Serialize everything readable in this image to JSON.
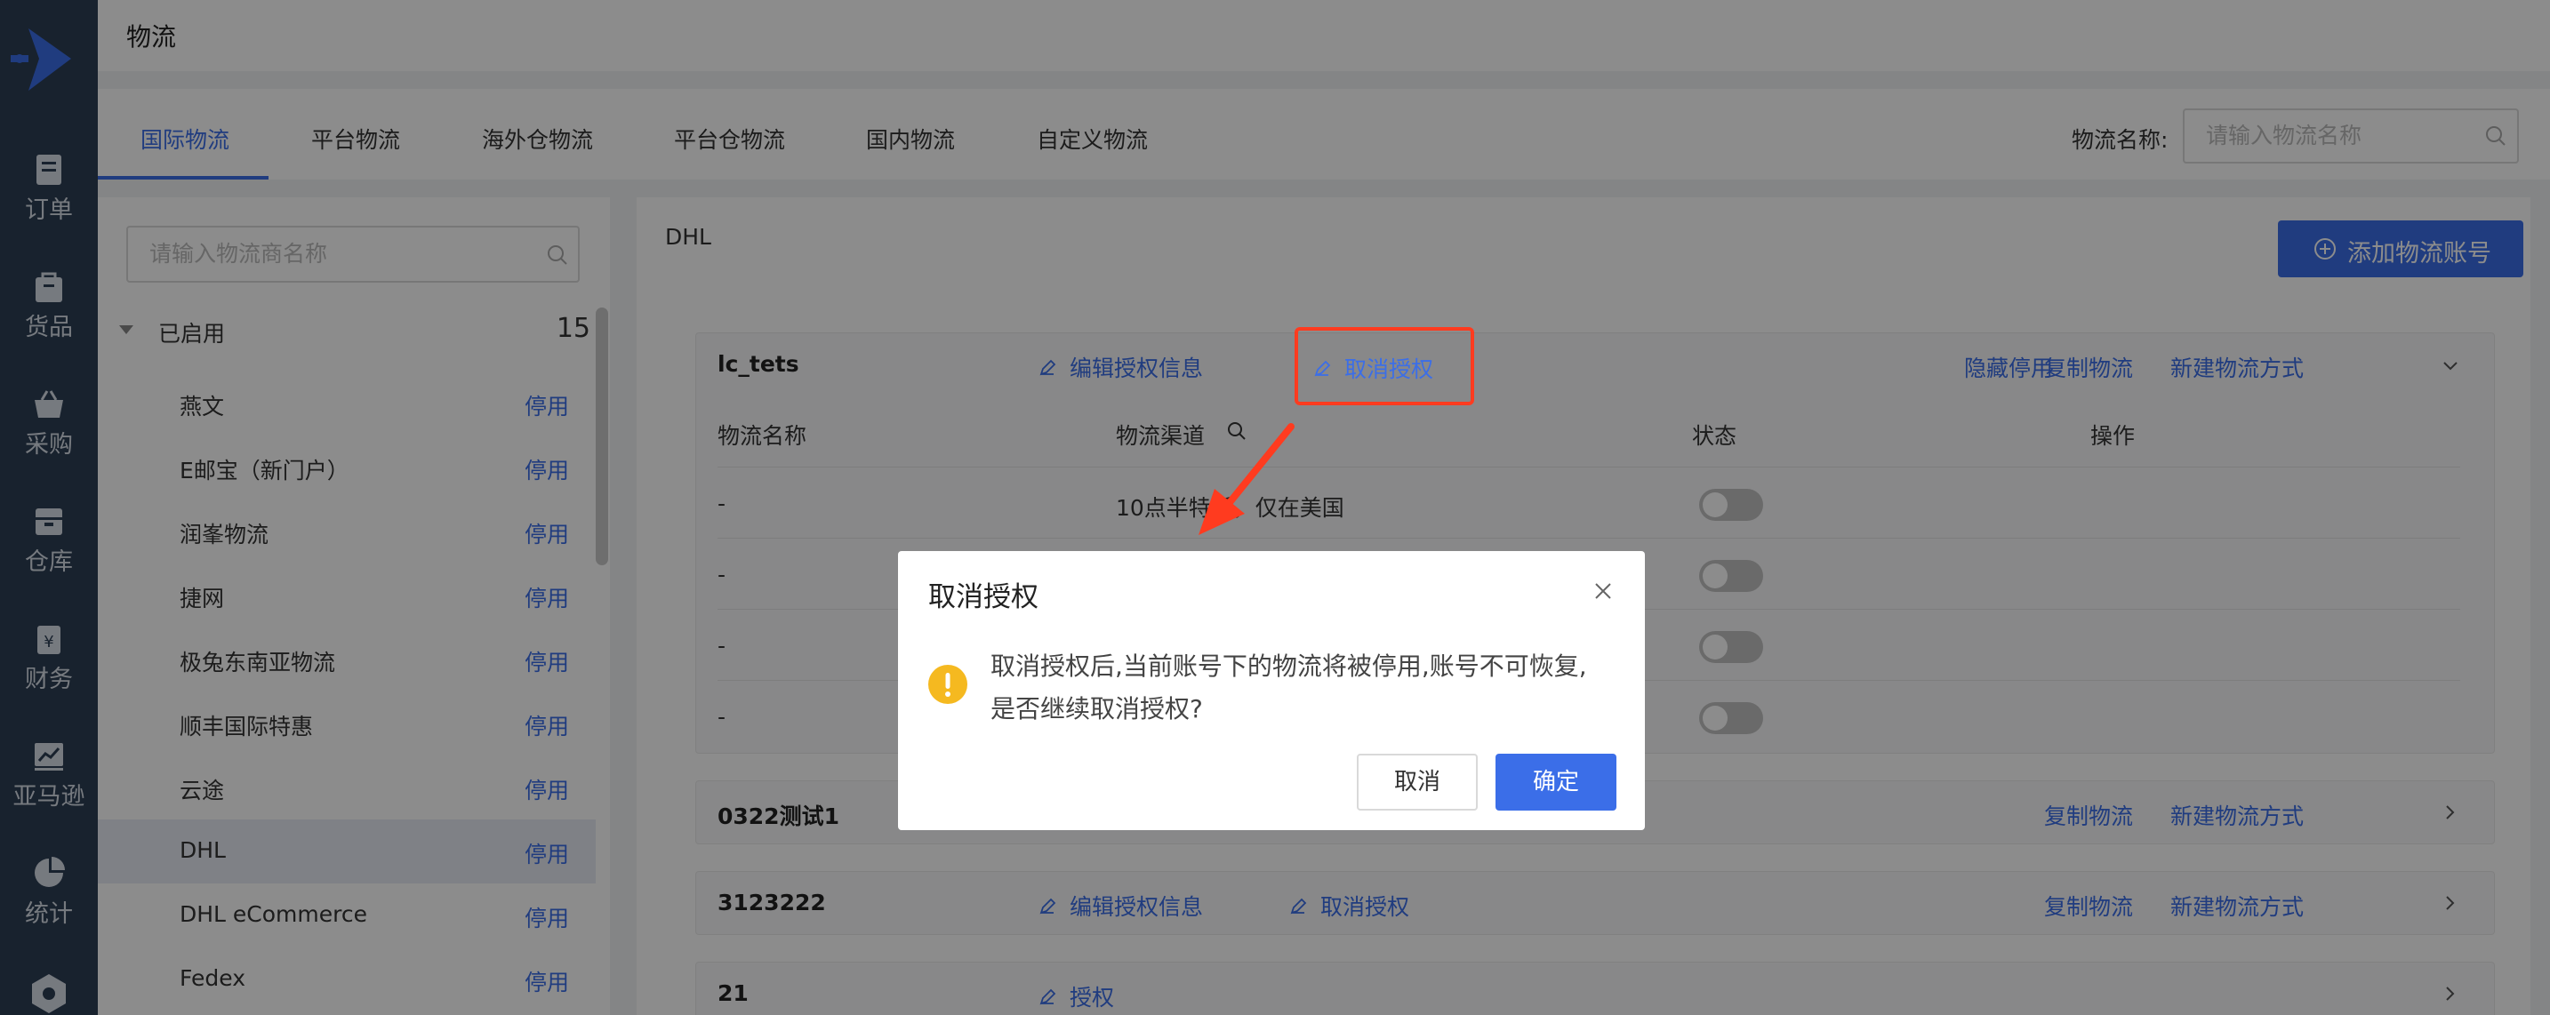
{
  "app": {
    "page_title": "物流"
  },
  "nav": [
    {
      "label": "订单",
      "icon": "order-icon"
    },
    {
      "label": "货品",
      "icon": "goods-icon"
    },
    {
      "label": "采购",
      "icon": "purchase-icon"
    },
    {
      "label": "仓库",
      "icon": "warehouse-icon"
    },
    {
      "label": "财务",
      "icon": "finance-icon"
    },
    {
      "label": "亚马逊",
      "icon": "amazon-icon"
    },
    {
      "label": "统计",
      "icon": "stats-icon"
    }
  ],
  "tabs": [
    {
      "label": "国际物流",
      "active": true
    },
    {
      "label": "平台物流"
    },
    {
      "label": "海外仓物流"
    },
    {
      "label": "平台仓物流"
    },
    {
      "label": "国内物流"
    },
    {
      "label": "自定义物流"
    }
  ],
  "filter": {
    "label": "物流名称:",
    "placeholder": "请输入物流名称"
  },
  "left": {
    "search_placeholder": "请输入物流商名称",
    "group": {
      "name": "已启用",
      "count": "15"
    },
    "carriers": [
      {
        "name": "燕文",
        "action": "停用"
      },
      {
        "name": "E邮宝（新门户）",
        "action": "停用"
      },
      {
        "name": "润峯物流",
        "action": "停用"
      },
      {
        "name": "捷网",
        "action": "停用"
      },
      {
        "name": "极兔东南亚物流",
        "action": "停用"
      },
      {
        "name": "顺丰国际特惠",
        "action": "停用"
      },
      {
        "name": "云途",
        "action": "停用"
      },
      {
        "name": "DHL",
        "action": "停用",
        "selected": true
      },
      {
        "name": "DHL eCommerce",
        "action": "停用"
      },
      {
        "name": "Fedex",
        "action": "停用"
      }
    ]
  },
  "right": {
    "title": "DHL",
    "add_button": "添加物流账号",
    "accounts": [
      {
        "name": "lc_tets",
        "edit": "编辑授权信息",
        "revoke": "取消授权",
        "hide": "隐藏停用",
        "copy": "复制物流",
        "new": "新建物流方式"
      },
      {
        "name": "0322测试1",
        "copy": "复制物流",
        "new": "新建物流方式"
      },
      {
        "name": "3123222",
        "edit": "编辑授权信息",
        "revoke": "取消授权",
        "copy": "复制物流",
        "new": "新建物流方式"
      },
      {
        "name": "21",
        "authorize": "授权"
      }
    ],
    "table": {
      "headers": [
        "物流名称",
        "物流渠道",
        "状态",
        "操作"
      ],
      "rows": [
        {
          "name": "-",
          "channel": "10点半特派，仅在美国"
        },
        {
          "name": "-",
          "channel": ""
        },
        {
          "name": "-",
          "channel": ""
        },
        {
          "name": "-",
          "channel": ""
        }
      ]
    }
  },
  "modal": {
    "title": "取消授权",
    "line1": "取消授权后,当前账号下的物流将被停用,账号不可恢复,",
    "line2": "是否继续取消授权?",
    "cancel": "取消",
    "confirm": "确定"
  },
  "colors": {
    "accent": "#3b6ee8",
    "sidebar": "#2c3e55",
    "highlight": "#ff3b1f",
    "warning": "#f5b920"
  }
}
